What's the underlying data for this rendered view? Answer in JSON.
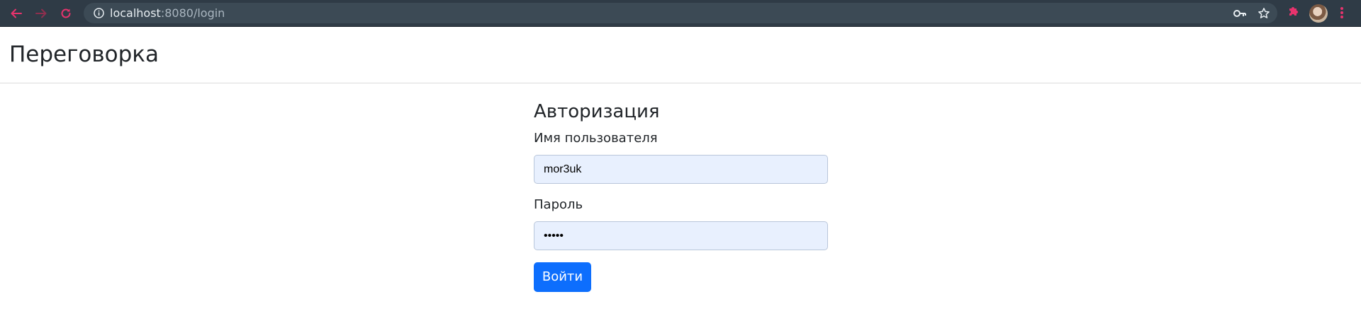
{
  "browser": {
    "url_host": "localhost",
    "url_path": ":8080/login",
    "back_icon": "arrow-left-icon",
    "forward_icon": "arrow-right-icon",
    "reload_icon": "reload-icon",
    "accent_color": "#e8336d"
  },
  "navbar": {
    "brand": "Переговорка"
  },
  "login_form": {
    "title": "Авторизация",
    "username_label": "Имя пользователя",
    "username_value": "mor3uk",
    "password_label": "Пароль",
    "password_value": "*****",
    "submit_label": "Войти",
    "submit_color": "#0d6efd"
  }
}
